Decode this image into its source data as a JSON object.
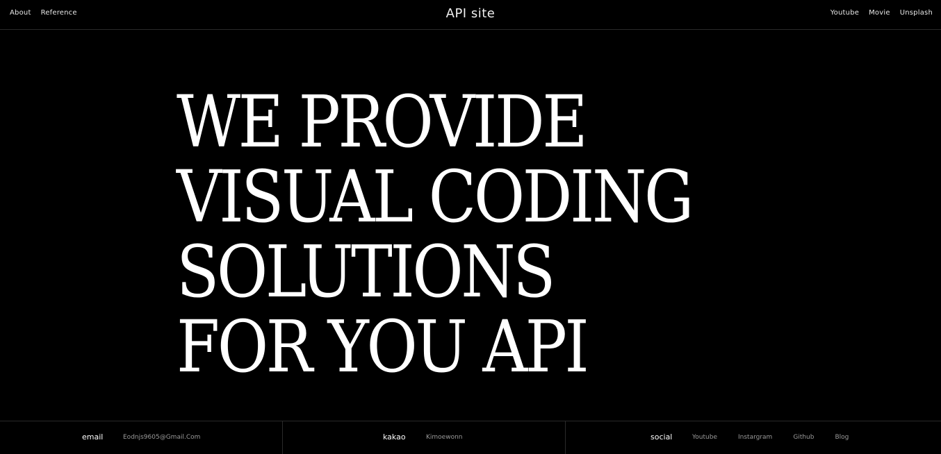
{
  "header": {
    "title": "API site",
    "nav_left": [
      "About",
      "Reference"
    ],
    "nav_right": [
      "Youtube",
      "Movie",
      "Unsplash"
    ]
  },
  "hero": {
    "lines": [
      "WE PROVIDE",
      "VISUAL CODING",
      "SOLUTIONS",
      "FOR YOU API"
    ]
  },
  "footer": {
    "email": {
      "label": "email",
      "value": "Eodnjs9605@Gmail.Com"
    },
    "kakao": {
      "label": "kakao",
      "value": "Kimoewonn"
    },
    "social": {
      "label": "social",
      "links": [
        "Youtube",
        "Instargram",
        "Github",
        "Blog"
      ]
    }
  },
  "colors": {
    "background": "#000000",
    "text": "#ffffff",
    "muted": "#9a9a9a",
    "divider": "#2a2a2a"
  }
}
